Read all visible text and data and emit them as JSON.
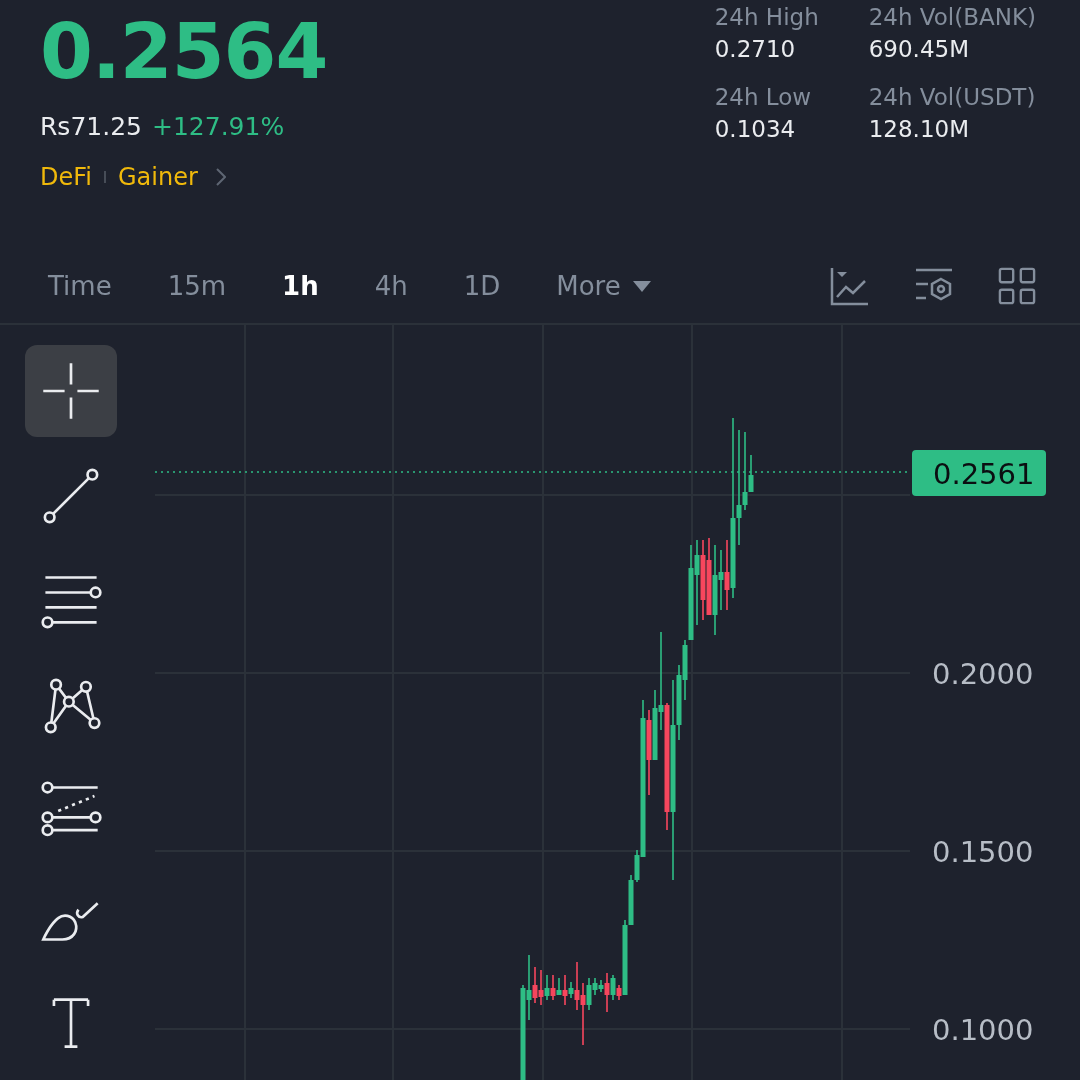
{
  "price": "0.2564",
  "fiat_price": "Rs71.25",
  "change": "+127.91%",
  "tags": [
    "DeFi",
    "Gainer"
  ],
  "stats": [
    {
      "label": "24h High",
      "value": "0.2710"
    },
    {
      "label": "24h Vol(BANK)",
      "value": "690.45M"
    },
    {
      "label": "24h Low",
      "value": "0.1034"
    },
    {
      "label": "24h Vol(USDT)",
      "value": "128.10M"
    }
  ],
  "intervals": [
    {
      "label": "Time",
      "selected": false,
      "kind": "tab"
    },
    {
      "label": "15m",
      "selected": false,
      "kind": "tab"
    },
    {
      "label": "1h",
      "selected": true,
      "kind": "tab"
    },
    {
      "label": "4h",
      "selected": false,
      "kind": "tab"
    },
    {
      "label": "1D",
      "selected": false,
      "kind": "tab"
    },
    {
      "label": "More",
      "selected": false,
      "kind": "dropdown"
    }
  ],
  "tools": [
    {
      "kind": "crosshair",
      "selected": true
    },
    {
      "kind": "trend-line",
      "selected": false
    },
    {
      "kind": "horizontal-lines",
      "selected": false
    },
    {
      "kind": "pattern",
      "selected": false
    },
    {
      "kind": "fibonacci",
      "selected": false
    },
    {
      "kind": "brush",
      "selected": false
    },
    {
      "kind": "text",
      "selected": false
    }
  ],
  "chart": {
    "axis_labels": [
      "0.2000",
      "0.1500",
      "0.1000"
    ],
    "last_price": "0.2561"
  }
}
